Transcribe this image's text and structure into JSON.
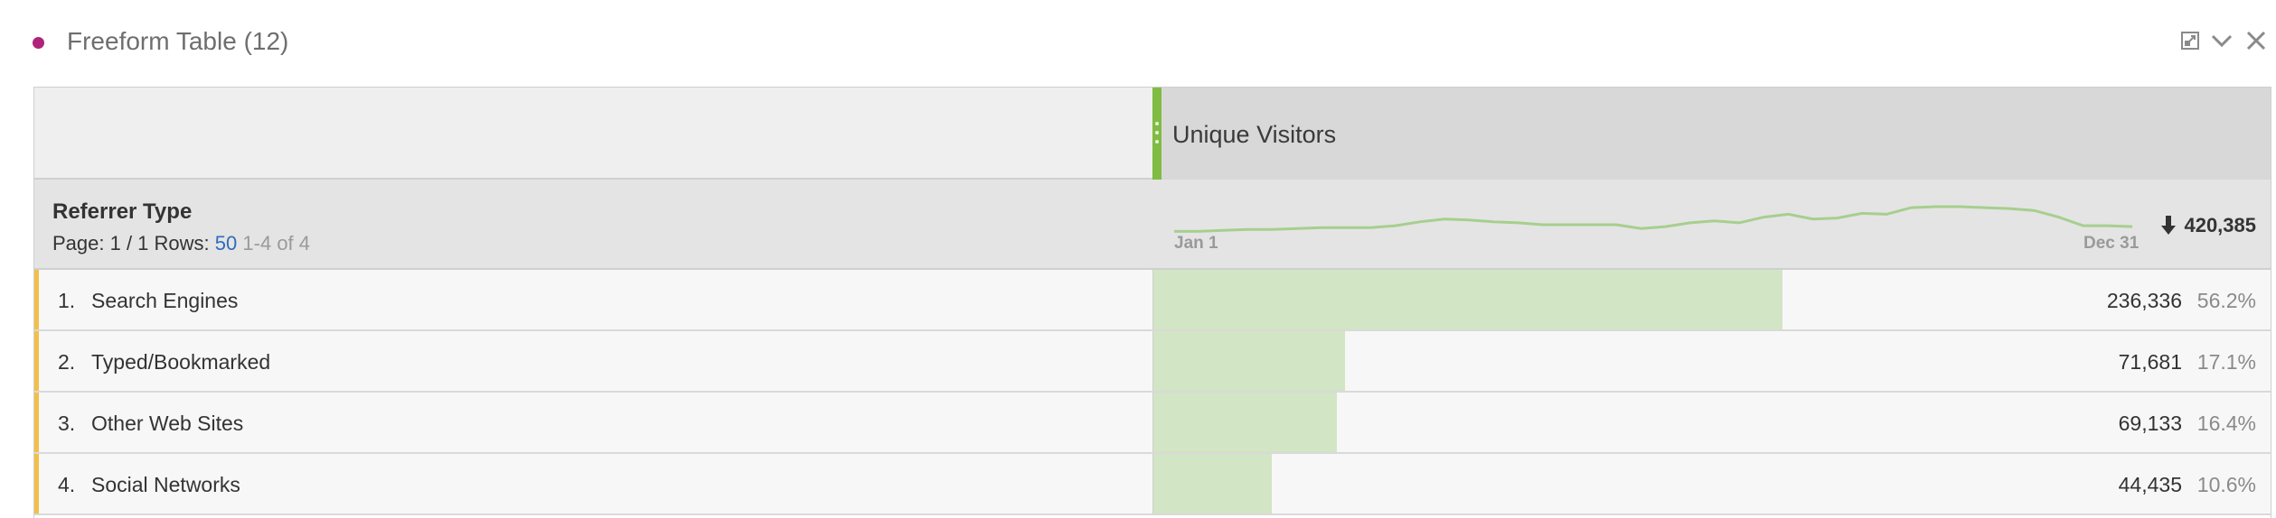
{
  "colors": {
    "status_dot": "#b0237a",
    "accent_green": "#7fbc41",
    "bar_fill": "#d2e5c4",
    "sparkline": "#a6cf8e",
    "row_flag": "#f2c04a"
  },
  "panel": {
    "title": "Freeform Table (12)",
    "icons": [
      "expand-icon",
      "chevron-down-icon",
      "close-icon"
    ]
  },
  "table": {
    "metric": {
      "label": "Unique Visitors",
      "total": "420,385",
      "sort_icon": "arrow-down-icon"
    },
    "dimension": {
      "label": "Referrer Type",
      "page_prefix": "Page: 1 / 1",
      "rows_label": "Rows:",
      "rows_value": "50",
      "range": "1-4 of 4"
    },
    "sparkline": {
      "start_label": "Jan 1",
      "end_label": "Dec 31",
      "values": [
        12,
        12,
        13,
        14,
        14,
        15,
        16,
        16,
        16,
        18,
        22,
        25,
        24,
        22,
        21,
        19,
        19,
        19,
        19,
        15,
        17,
        21,
        23,
        21,
        27,
        30,
        25,
        26,
        31,
        30,
        37,
        38,
        38,
        37,
        36,
        34,
        27,
        18,
        18,
        17
      ]
    },
    "rows": [
      {
        "num": "1.",
        "label": "Search Engines",
        "value": "236,336",
        "pct": "56.2%",
        "share": 0.562
      },
      {
        "num": "2.",
        "label": "Typed/Bookmarked",
        "value": "71,681",
        "pct": "17.1%",
        "share": 0.171
      },
      {
        "num": "3.",
        "label": "Other Web Sites",
        "value": "69,133",
        "pct": "16.4%",
        "share": 0.164
      },
      {
        "num": "4.",
        "label": "Social Networks",
        "value": "44,435",
        "pct": "10.6%",
        "share": 0.106
      }
    ]
  }
}
